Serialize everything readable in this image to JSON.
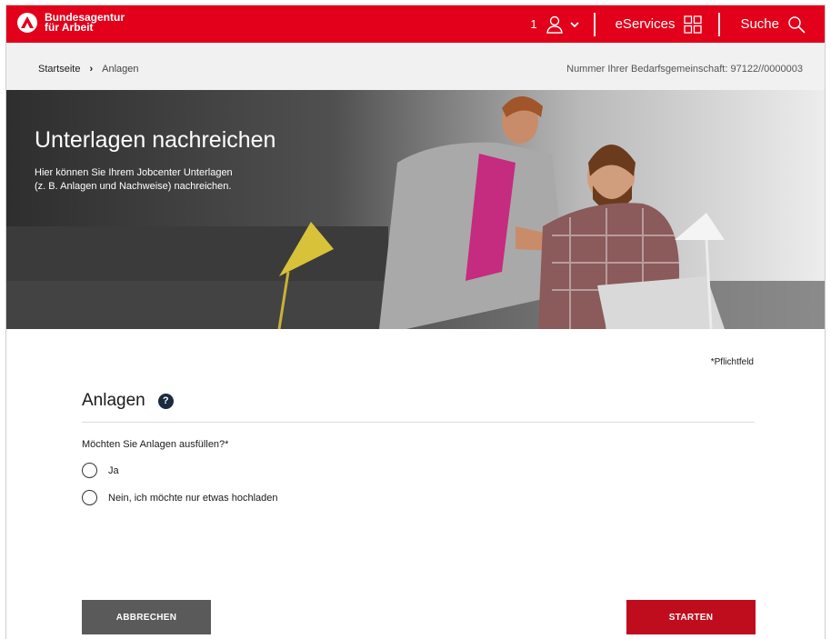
{
  "header": {
    "brand_line1": "Bundesagentur",
    "brand_line2": "für Arbeit",
    "user_count": "1",
    "eservices_label": "eServices",
    "search_label": "Suche",
    "brand_color": "#e2001a"
  },
  "breadcrumb": {
    "home": "Startseite",
    "separator": "›",
    "current": "Anlagen"
  },
  "bedarfsgemeinschaft": "Nummer Ihrer Bedarfsgemeinschaft: 97122//0000003",
  "hero": {
    "title": "Unterlagen nachreichen",
    "text_line1": "Hier können Sie Ihrem Jobcenter Unterlagen",
    "text_line2": "(z. B. Anlagen und Nachweise) nachreichen."
  },
  "form": {
    "required_note": "*Pflichtfeld",
    "section_title": "Anlagen",
    "help_symbol": "?",
    "question": "Möchten Sie Anlagen ausfüllen?*",
    "options": [
      {
        "label": "Ja"
      },
      {
        "label": "Nein, ich möchte nur etwas hochladen"
      }
    ]
  },
  "buttons": {
    "cancel": "ABBRECHEN",
    "start": "STARTEN"
  }
}
